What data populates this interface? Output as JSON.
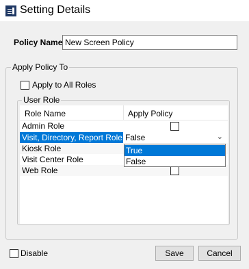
{
  "window": {
    "title": "Setting Details"
  },
  "policy": {
    "name_label": "Policy Name",
    "name_value": "New Screen Policy"
  },
  "apply_group": {
    "title": "Apply Policy To",
    "apply_all_label": "Apply to All Roles"
  },
  "user_role": {
    "title": "User Role",
    "columns": [
      "Role Name",
      "Apply Policy"
    ],
    "rows": [
      {
        "name": "Admin Role",
        "apply": false
      },
      {
        "name": "Visit, Directory, Report Role",
        "apply": "False"
      },
      {
        "name": "Kiosk Role",
        "apply": false
      },
      {
        "name": "Visit Center Role",
        "apply": false
      },
      {
        "name": "Web Role",
        "apply": false
      }
    ],
    "dropdown": {
      "value": "False",
      "options": [
        "True",
        "False"
      ],
      "highlighted": "True"
    }
  },
  "footer": {
    "disable_label": "Disable",
    "save_label": "Save",
    "cancel_label": "Cancel"
  }
}
